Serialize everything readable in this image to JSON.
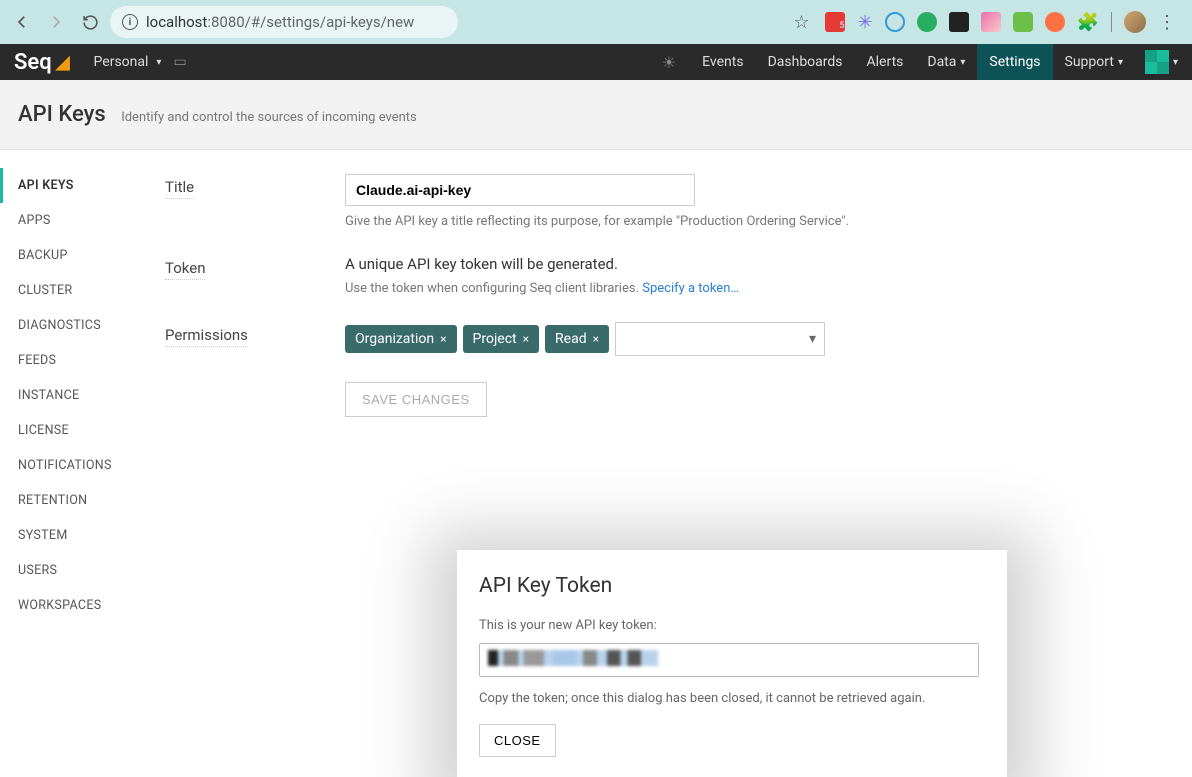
{
  "browser": {
    "url_host": "localhost",
    "url_port_path": ":8080/#/settings/api-keys/new",
    "ext_badge": "5"
  },
  "topbar": {
    "logo_text": "Seq",
    "workspace": "Personal",
    "nav": {
      "events": "Events",
      "dashboards": "Dashboards",
      "alerts": "Alerts",
      "data": "Data",
      "settings": "Settings",
      "support": "Support"
    }
  },
  "page": {
    "title": "API Keys",
    "subtitle": "Identify and control the sources of incoming events"
  },
  "sidebar": {
    "items": [
      "API KEYS",
      "APPS",
      "BACKUP",
      "CLUSTER",
      "DIAGNOSTICS",
      "FEEDS",
      "INSTANCE",
      "LICENSE",
      "NOTIFICATIONS",
      "RETENTION",
      "SYSTEM",
      "USERS",
      "WORKSPACES"
    ]
  },
  "form": {
    "title_label": "Title",
    "title_value": "Claude.ai-api-key",
    "title_help": "Give the API key a title reflecting its purpose, for example \"Production Ordering Service\".",
    "token_label": "Token",
    "token_desc": "A unique API key token will be generated.",
    "token_help": "Use the token when configuring Seq client libraries. ",
    "token_link": "Specify a token…",
    "perm_label": "Permissions",
    "tags": [
      "Organization",
      "Project",
      "Read"
    ],
    "save_label": "SAVE CHANGES"
  },
  "modal": {
    "title": "API Key Token",
    "intro": "This is your new API key token:",
    "warn": "Copy the token; once this dialog has been closed, it cannot be retrieved again.",
    "close": "CLOSE"
  }
}
